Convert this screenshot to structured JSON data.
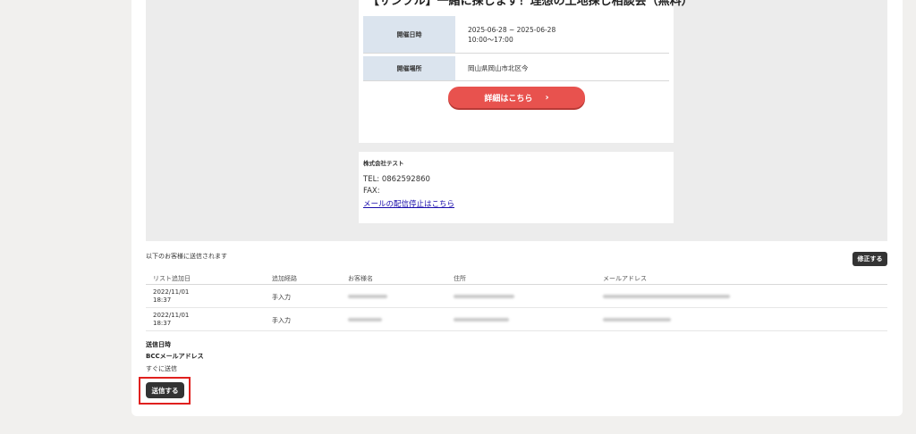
{
  "event": {
    "title": "【サンプル】一緒に探します！理想の土地探し相談会（無料）",
    "date_label": "開催日時",
    "date_range": "2025-06-28 ~ 2025-06-28",
    "time_range": "10:00〜17:00",
    "place_label": "開催場所",
    "place_value": "岡山県岡山市北区今",
    "detail_button": "詳細はこちら",
    "detail_chevron": "›"
  },
  "footer": {
    "company": "株式会社テスト",
    "tel": "TEL: 0862592860",
    "fax": "FAX:",
    "unsubscribe": "メールの配信停止はこちら"
  },
  "recipients": {
    "notice": "以下のお客様に送信されます",
    "edit_button": "修正する",
    "columns": [
      "リスト追加日",
      "追加経路",
      "お客様名",
      "住所",
      "メールアドレス"
    ],
    "rows": [
      {
        "date": "2022/11/01",
        "time": "18:37",
        "route": "手入力"
      },
      {
        "date": "2022/11/01",
        "time": "18:37",
        "route": "手入力"
      }
    ]
  },
  "settings": {
    "schedule_label": "送信日時",
    "bcc_label": "BCCメールアドレス",
    "schedule_value": "すぐに送信",
    "send_button": "送信する"
  }
}
